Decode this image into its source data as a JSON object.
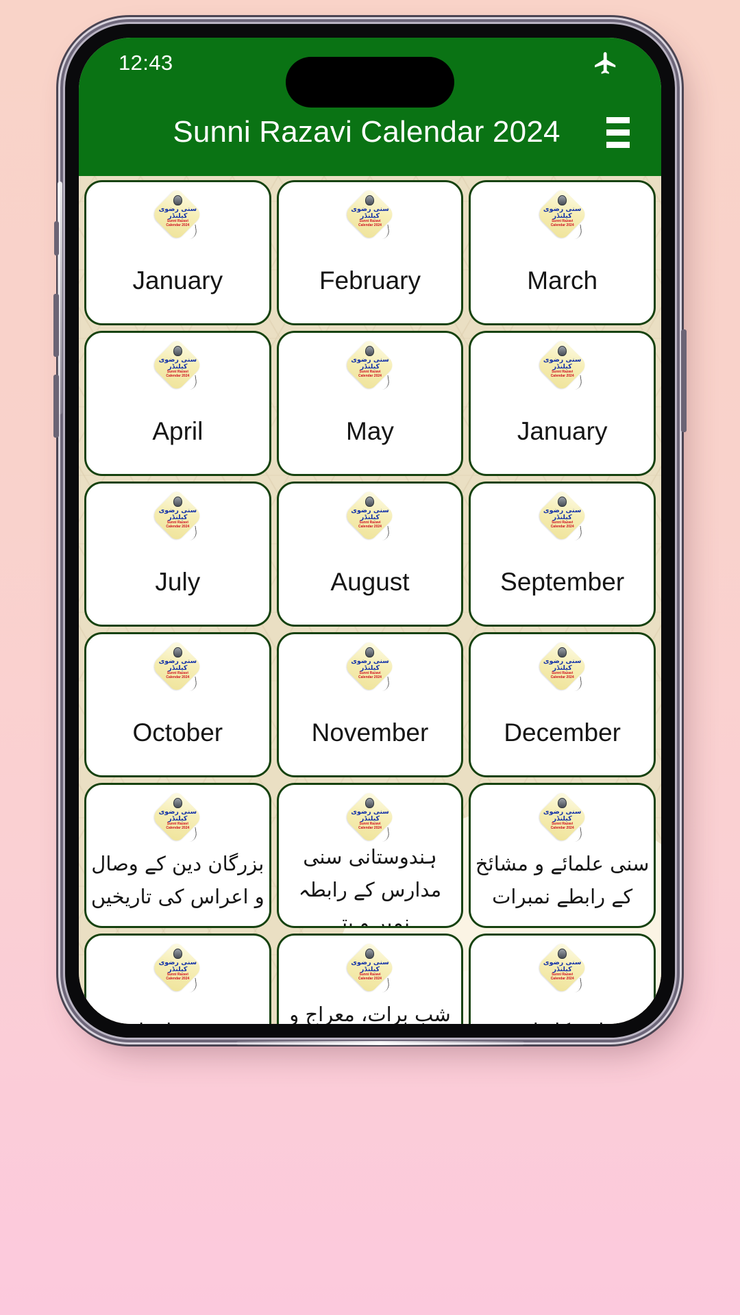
{
  "status_bar": {
    "time": "12:43",
    "icons": [
      "airplane-mode-icon"
    ]
  },
  "app_bar": {
    "title": "Sunni Razavi Calendar 2024",
    "menu_icon": "hamburger-menu-icon"
  },
  "colors": {
    "brand_green": "#0a7314",
    "card_border": "#16420f",
    "card_background": "#ffffff",
    "content_background": "#eadfc3",
    "page_background": "#f9d3c8"
  },
  "logo": {
    "line1": "سنی رضوی",
    "line2": "کیلنڈر",
    "subtitle_line1": "Sunni Razavi",
    "subtitle_line2": "Calendar 2024"
  },
  "grid": {
    "cards": [
      {
        "label": "January",
        "lang": "en"
      },
      {
        "label": "February",
        "lang": "en"
      },
      {
        "label": "March",
        "lang": "en"
      },
      {
        "label": "April",
        "lang": "en"
      },
      {
        "label": "May",
        "lang": "en"
      },
      {
        "label": "January",
        "lang": "en"
      },
      {
        "label": "July",
        "lang": "en"
      },
      {
        "label": "August",
        "lang": "en"
      },
      {
        "label": "September",
        "lang": "en"
      },
      {
        "label": "October",
        "lang": "en"
      },
      {
        "label": "November",
        "lang": "en"
      },
      {
        "label": "December",
        "lang": "en"
      },
      {
        "label": "بزرگان دین کے وصال و اعراس کی تاریخیں",
        "lang": "ur"
      },
      {
        "label": "ہندوستانی سنی مدارس کے رابطہ نمبر و پتے",
        "lang": "ur"
      },
      {
        "label": "سنی علمائے و مشائخ کے رابطے نمبرات",
        "lang": "ur"
      },
      {
        "label": "دینی معلومات",
        "lang": "ur"
      },
      {
        "label": "شب برات، معراج و قدر کے نوافل",
        "lang": "ur"
      },
      {
        "label": "قربانی کا طریقہ",
        "lang": "ur"
      }
    ]
  }
}
